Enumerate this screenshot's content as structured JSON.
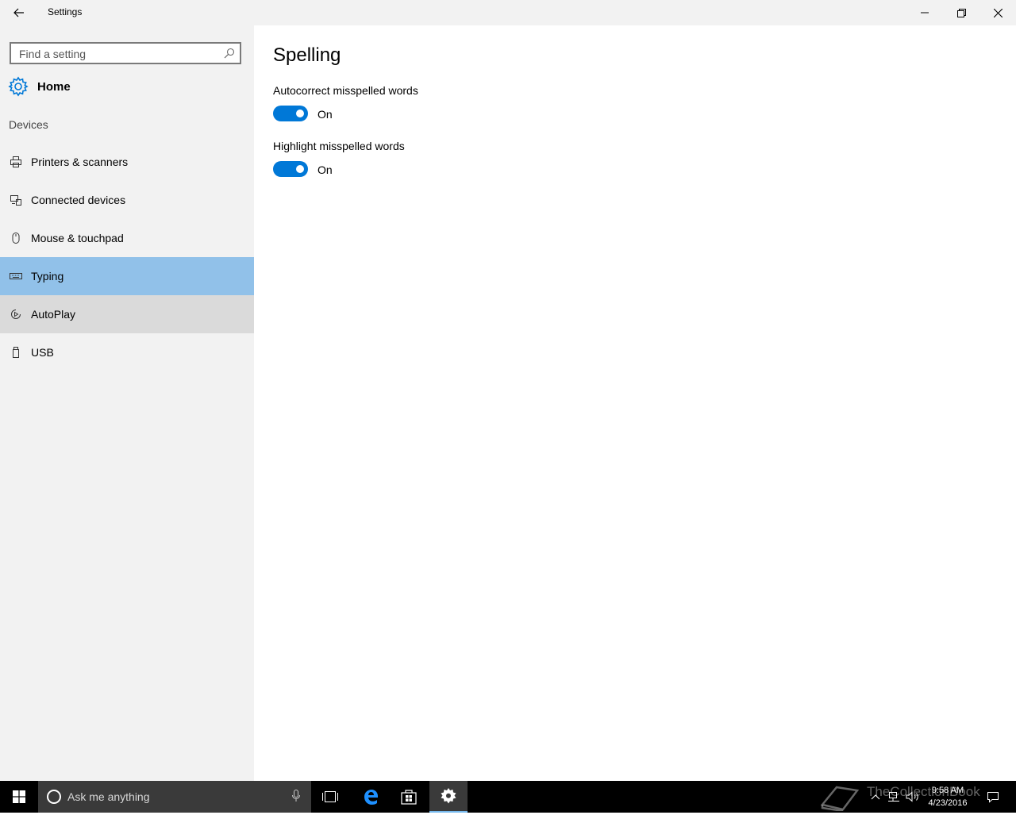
{
  "window": {
    "title": "Settings"
  },
  "search": {
    "placeholder": "Find a setting"
  },
  "home": {
    "label": "Home"
  },
  "sidebar": {
    "section": "Devices",
    "items": [
      {
        "label": "Printers & scanners",
        "icon": "printer-icon"
      },
      {
        "label": "Connected devices",
        "icon": "connected-devices-icon"
      },
      {
        "label": "Mouse & touchpad",
        "icon": "mouse-icon"
      },
      {
        "label": "Typing",
        "icon": "keyboard-icon",
        "selected": true
      },
      {
        "label": "AutoPlay",
        "icon": "autoplay-icon",
        "hover": true
      },
      {
        "label": "USB",
        "icon": "usb-icon"
      }
    ]
  },
  "main": {
    "title": "Spelling",
    "settings": [
      {
        "label": "Autocorrect misspelled words",
        "state": "On",
        "on": true
      },
      {
        "label": "Highlight misspelled words",
        "state": "On",
        "on": true
      }
    ]
  },
  "taskbar": {
    "search_placeholder": "Ask me anything",
    "time": "9:58 AM",
    "date": "4/23/2016",
    "watermark": "TheCollectionBook"
  },
  "colors": {
    "accent": "#0078d7",
    "selected": "#91c1e9",
    "sidebar": "#f2f2f2",
    "taskbar": "#000000"
  }
}
